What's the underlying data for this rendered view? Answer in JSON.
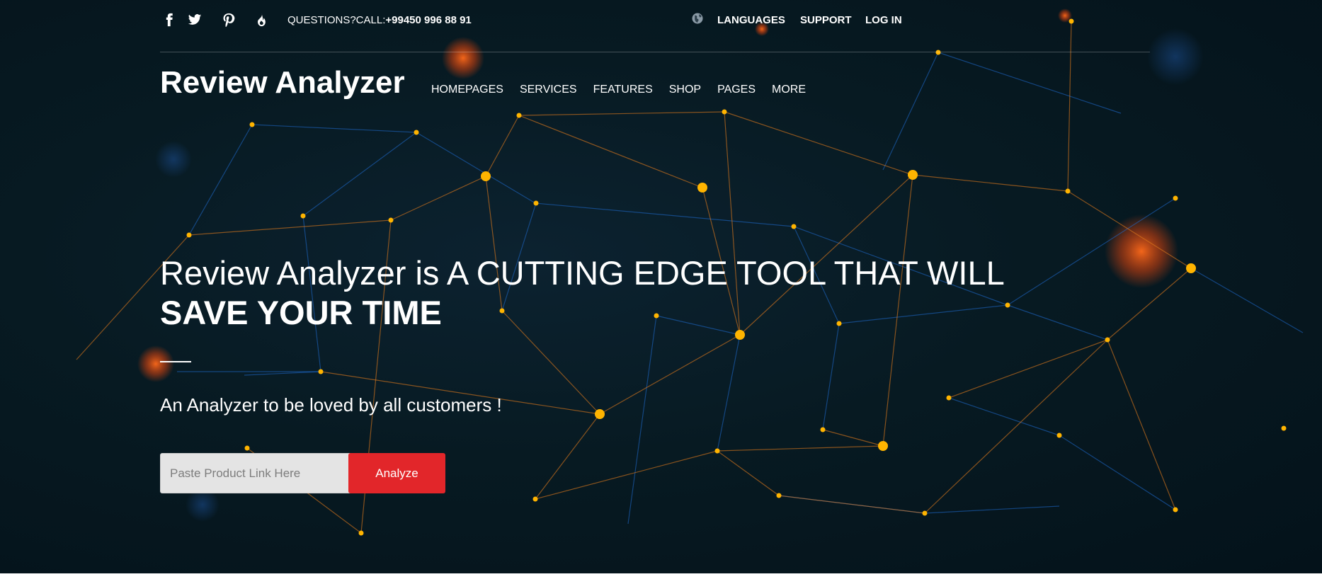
{
  "topbar": {
    "social_icons": [
      "facebook-icon",
      "twitter-icon",
      "pinterest-icon",
      "fire-icon"
    ],
    "questions_label": "QUESTIONS?CALL:",
    "phone": "+99450 996 88 91",
    "globe_icon": "globe-icon",
    "links": [
      "LANGUAGES",
      "SUPPORT",
      "LOG IN"
    ]
  },
  "header": {
    "brand": "Review Analyzer",
    "nav": [
      "HOMEPAGES",
      "SERVICES",
      "FEATURES",
      "SHOP",
      "PAGES",
      "MORE"
    ]
  },
  "hero": {
    "headline_line1": "Review Analyzer is A CUTTING EDGE TOOL THAT WILL",
    "headline_line2": "SAVE YOUR TIME",
    "subtitle": "An Analyzer to be loved by all customers !",
    "input_placeholder": "Paste Product Link Here",
    "button_label": "Analyze"
  },
  "colors": {
    "background": "#071a22",
    "accent_button": "#e2262a",
    "node_orange": "#ffb400",
    "line_blue": "#1e6fd8",
    "line_orange": "#e0721c"
  }
}
